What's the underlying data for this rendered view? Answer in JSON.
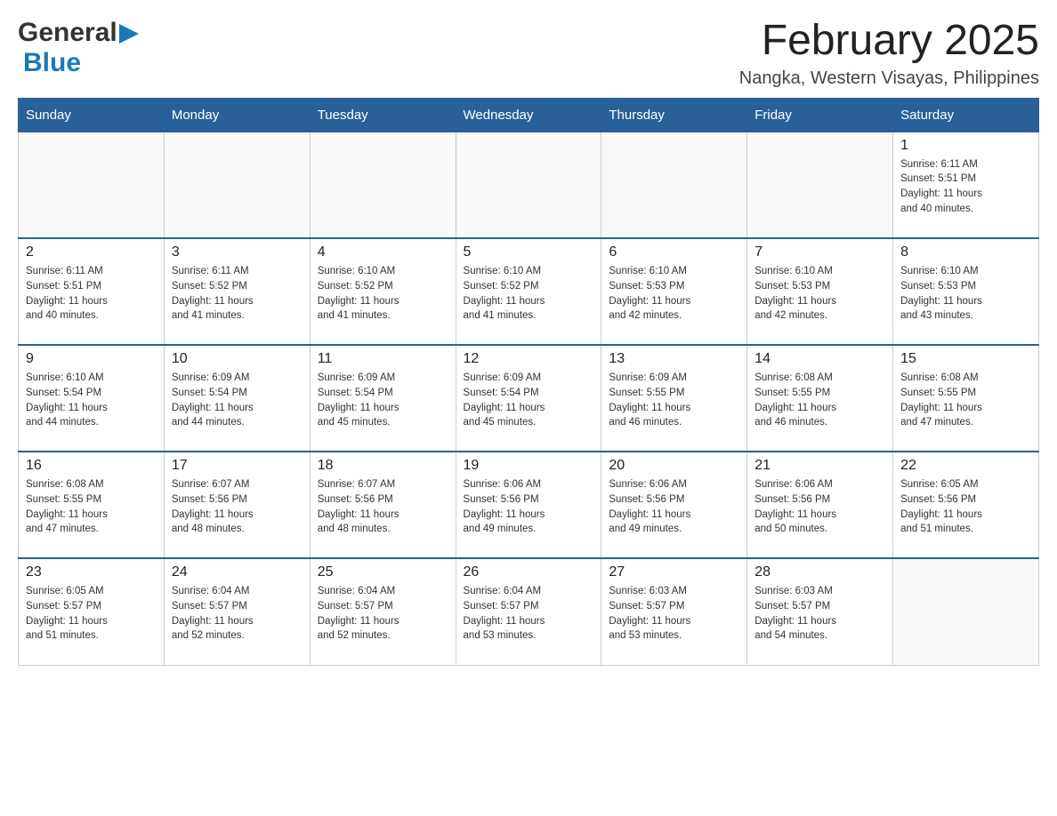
{
  "header": {
    "logo_general": "General",
    "logo_blue": "Blue",
    "month_title": "February 2025",
    "location": "Nangka, Western Visayas, Philippines"
  },
  "days_of_week": [
    "Sunday",
    "Monday",
    "Tuesday",
    "Wednesday",
    "Thursday",
    "Friday",
    "Saturday"
  ],
  "weeks": [
    [
      {
        "day": "",
        "info": ""
      },
      {
        "day": "",
        "info": ""
      },
      {
        "day": "",
        "info": ""
      },
      {
        "day": "",
        "info": ""
      },
      {
        "day": "",
        "info": ""
      },
      {
        "day": "",
        "info": ""
      },
      {
        "day": "1",
        "info": "Sunrise: 6:11 AM\nSunset: 5:51 PM\nDaylight: 11 hours\nand 40 minutes."
      }
    ],
    [
      {
        "day": "2",
        "info": "Sunrise: 6:11 AM\nSunset: 5:51 PM\nDaylight: 11 hours\nand 40 minutes."
      },
      {
        "day": "3",
        "info": "Sunrise: 6:11 AM\nSunset: 5:52 PM\nDaylight: 11 hours\nand 41 minutes."
      },
      {
        "day": "4",
        "info": "Sunrise: 6:10 AM\nSunset: 5:52 PM\nDaylight: 11 hours\nand 41 minutes."
      },
      {
        "day": "5",
        "info": "Sunrise: 6:10 AM\nSunset: 5:52 PM\nDaylight: 11 hours\nand 41 minutes."
      },
      {
        "day": "6",
        "info": "Sunrise: 6:10 AM\nSunset: 5:53 PM\nDaylight: 11 hours\nand 42 minutes."
      },
      {
        "day": "7",
        "info": "Sunrise: 6:10 AM\nSunset: 5:53 PM\nDaylight: 11 hours\nand 42 minutes."
      },
      {
        "day": "8",
        "info": "Sunrise: 6:10 AM\nSunset: 5:53 PM\nDaylight: 11 hours\nand 43 minutes."
      }
    ],
    [
      {
        "day": "9",
        "info": "Sunrise: 6:10 AM\nSunset: 5:54 PM\nDaylight: 11 hours\nand 44 minutes."
      },
      {
        "day": "10",
        "info": "Sunrise: 6:09 AM\nSunset: 5:54 PM\nDaylight: 11 hours\nand 44 minutes."
      },
      {
        "day": "11",
        "info": "Sunrise: 6:09 AM\nSunset: 5:54 PM\nDaylight: 11 hours\nand 45 minutes."
      },
      {
        "day": "12",
        "info": "Sunrise: 6:09 AM\nSunset: 5:54 PM\nDaylight: 11 hours\nand 45 minutes."
      },
      {
        "day": "13",
        "info": "Sunrise: 6:09 AM\nSunset: 5:55 PM\nDaylight: 11 hours\nand 46 minutes."
      },
      {
        "day": "14",
        "info": "Sunrise: 6:08 AM\nSunset: 5:55 PM\nDaylight: 11 hours\nand 46 minutes."
      },
      {
        "day": "15",
        "info": "Sunrise: 6:08 AM\nSunset: 5:55 PM\nDaylight: 11 hours\nand 47 minutes."
      }
    ],
    [
      {
        "day": "16",
        "info": "Sunrise: 6:08 AM\nSunset: 5:55 PM\nDaylight: 11 hours\nand 47 minutes."
      },
      {
        "day": "17",
        "info": "Sunrise: 6:07 AM\nSunset: 5:56 PM\nDaylight: 11 hours\nand 48 minutes."
      },
      {
        "day": "18",
        "info": "Sunrise: 6:07 AM\nSunset: 5:56 PM\nDaylight: 11 hours\nand 48 minutes."
      },
      {
        "day": "19",
        "info": "Sunrise: 6:06 AM\nSunset: 5:56 PM\nDaylight: 11 hours\nand 49 minutes."
      },
      {
        "day": "20",
        "info": "Sunrise: 6:06 AM\nSunset: 5:56 PM\nDaylight: 11 hours\nand 49 minutes."
      },
      {
        "day": "21",
        "info": "Sunrise: 6:06 AM\nSunset: 5:56 PM\nDaylight: 11 hours\nand 50 minutes."
      },
      {
        "day": "22",
        "info": "Sunrise: 6:05 AM\nSunset: 5:56 PM\nDaylight: 11 hours\nand 51 minutes."
      }
    ],
    [
      {
        "day": "23",
        "info": "Sunrise: 6:05 AM\nSunset: 5:57 PM\nDaylight: 11 hours\nand 51 minutes."
      },
      {
        "day": "24",
        "info": "Sunrise: 6:04 AM\nSunset: 5:57 PM\nDaylight: 11 hours\nand 52 minutes."
      },
      {
        "day": "25",
        "info": "Sunrise: 6:04 AM\nSunset: 5:57 PM\nDaylight: 11 hours\nand 52 minutes."
      },
      {
        "day": "26",
        "info": "Sunrise: 6:04 AM\nSunset: 5:57 PM\nDaylight: 11 hours\nand 53 minutes."
      },
      {
        "day": "27",
        "info": "Sunrise: 6:03 AM\nSunset: 5:57 PM\nDaylight: 11 hours\nand 53 minutes."
      },
      {
        "day": "28",
        "info": "Sunrise: 6:03 AM\nSunset: 5:57 PM\nDaylight: 11 hours\nand 54 minutes."
      },
      {
        "day": "",
        "info": ""
      }
    ]
  ]
}
